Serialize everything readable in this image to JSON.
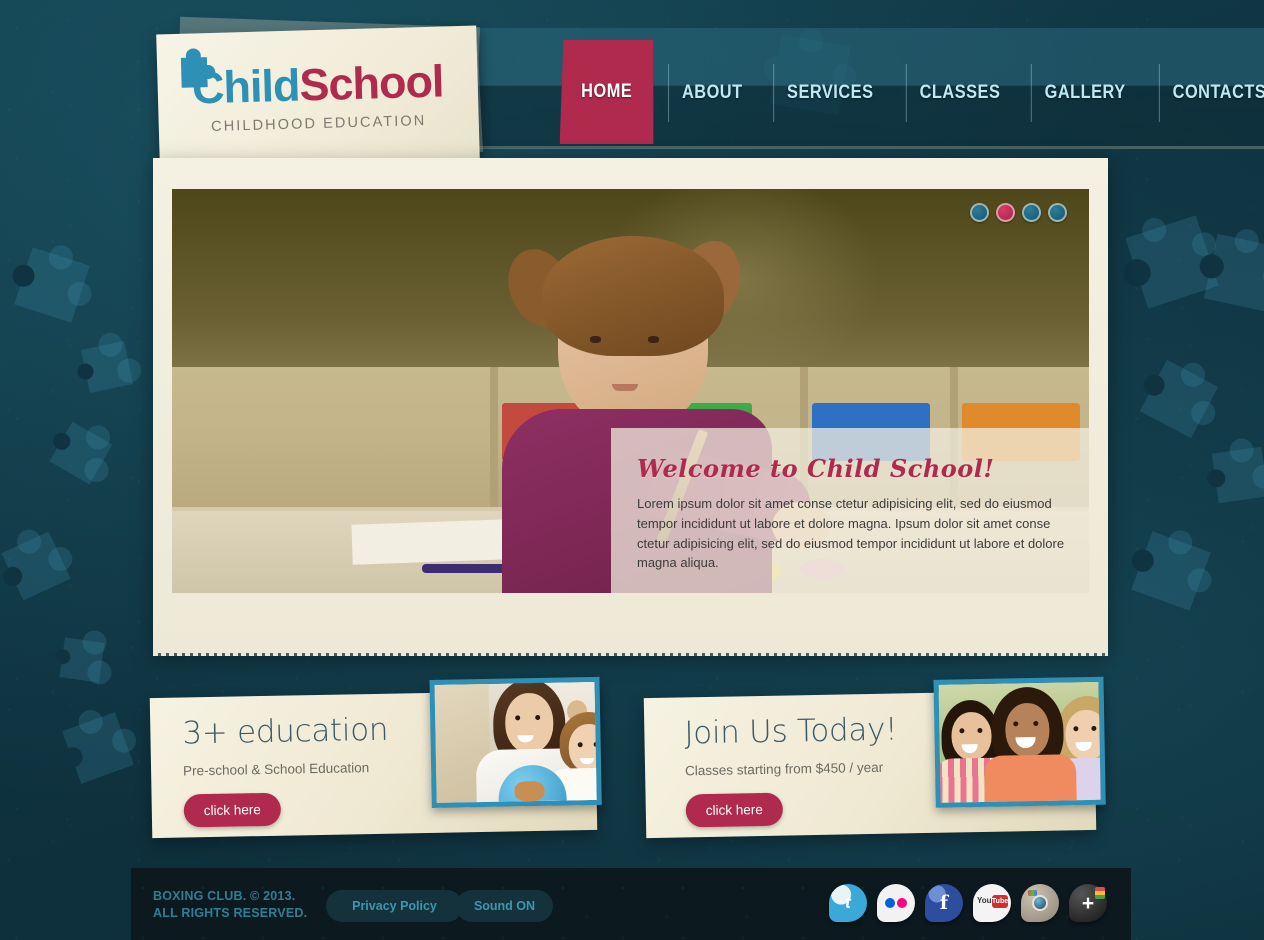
{
  "site": {
    "logo": {
      "part1": "Child",
      "part2": "School",
      "tagline": "CHILDHOOD EDUCATION",
      "icon": "puzzle-piece-icon"
    },
    "colors": {
      "crimson": "#b02a4e",
      "teal": "#2e90b5",
      "cream": "#f2eee1",
      "dark_bg": "#0f3340",
      "footer_bg": "#0c1a20"
    }
  },
  "nav": {
    "items": [
      {
        "label": "HOME",
        "active": true
      },
      {
        "label": "ABOUT",
        "active": false
      },
      {
        "label": "SERVICES",
        "active": false
      },
      {
        "label": "CLASSES",
        "active": false
      },
      {
        "label": "GALLERY",
        "active": false
      },
      {
        "label": "CONTACTS",
        "active": false
      }
    ]
  },
  "slider": {
    "dots": [
      {
        "index": "1",
        "active": false
      },
      {
        "index": "2",
        "active": true
      },
      {
        "index": "3",
        "active": false
      },
      {
        "index": "4",
        "active": false
      }
    ],
    "caption": {
      "title": "Welcome to Child School!",
      "text": "Lorem ipsum dolor sit amet conse ctetur adipisicing elit, sed do eiusmod tempor incididunt ut labore et dolore magna. Ipsum dolor sit amet conse ctetur adipisicing elit, sed do eiusmod tempor incididunt ut labore et dolore magna aliqua."
    },
    "image_alt": "young girl drawing at classroom desk"
  },
  "promos": [
    {
      "title": "3+ education",
      "subtitle": "Pre-school & School Education",
      "button": "click here",
      "image_alt": "teacher and child with globe"
    },
    {
      "title": "Join Us Today!",
      "subtitle": "Classes starting from $450 / year",
      "button": "click here",
      "image_alt": "three smiling girls outdoors"
    }
  ],
  "footer": {
    "copyright_line1": "BOXING CLUB. © 2013.",
    "copyright_line2": "ALL RIGHTS RESERVED.",
    "privacy_label": "Privacy Policy",
    "sound_label": "Sound ON",
    "social": [
      {
        "name": "twitter-icon",
        "glyph": "t"
      },
      {
        "name": "flickr-icon",
        "glyph": ""
      },
      {
        "name": "facebook-icon",
        "glyph": "f"
      },
      {
        "name": "youtube-icon",
        "glyph": "You"
      },
      {
        "name": "instagram-icon",
        "glyph": ""
      },
      {
        "name": "googleplus-icon",
        "glyph": "+"
      }
    ]
  }
}
